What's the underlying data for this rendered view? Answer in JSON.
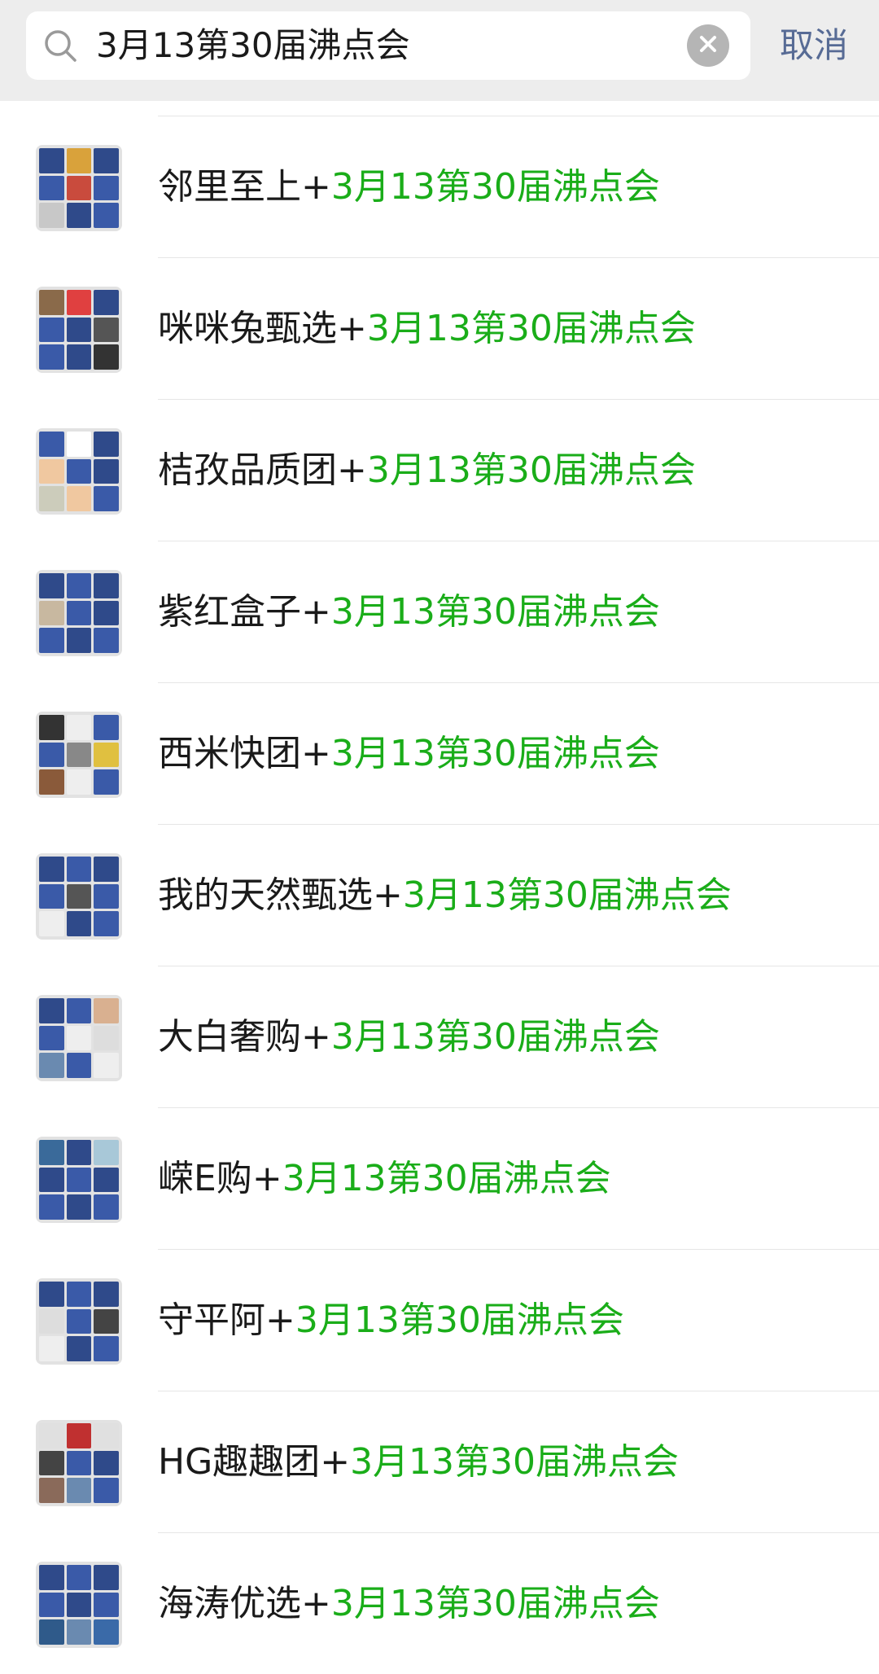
{
  "search": {
    "query": "3月13第30届沸点会",
    "cancel_label": "取消"
  },
  "results": [
    {
      "name": "邻里至上",
      "joiner": "+",
      "keyword": "3月13第30届沸点会"
    },
    {
      "name": "咪咪兔甄选",
      "joiner": "+",
      "keyword": "3月13第30届沸点会"
    },
    {
      "name": "桔孜品质团",
      "joiner": "+",
      "keyword": "3月13第30届沸点会"
    },
    {
      "name": "紫红盒子",
      "joiner": "+",
      "keyword": "3月13第30届沸点会"
    },
    {
      "name": "西米快团",
      "joiner": "+",
      "keyword": "3月13第30届沸点会"
    },
    {
      "name": "我的天然甄选",
      "joiner": "+",
      "keyword": "3月13第30届沸点会"
    },
    {
      "name": "大白奢购",
      "joiner": "+",
      "keyword": "3月13第30届沸点会"
    },
    {
      "name": "嵘E购",
      "joiner": "+",
      "keyword": "3月13第30届沸点会"
    },
    {
      "name": "守平阿",
      "joiner": "+",
      "keyword": "3月13第30届沸点会"
    },
    {
      "name": "HG趣趣团",
      "joiner": "+",
      "keyword": "3月13第30届沸点会"
    },
    {
      "name": "海涛优选",
      "joiner": "+",
      "keyword": "3月13第30届沸点会"
    }
  ],
  "colors": {
    "highlight": "#1aad19",
    "cancel": "#576b95",
    "header_bg": "#ededed"
  }
}
